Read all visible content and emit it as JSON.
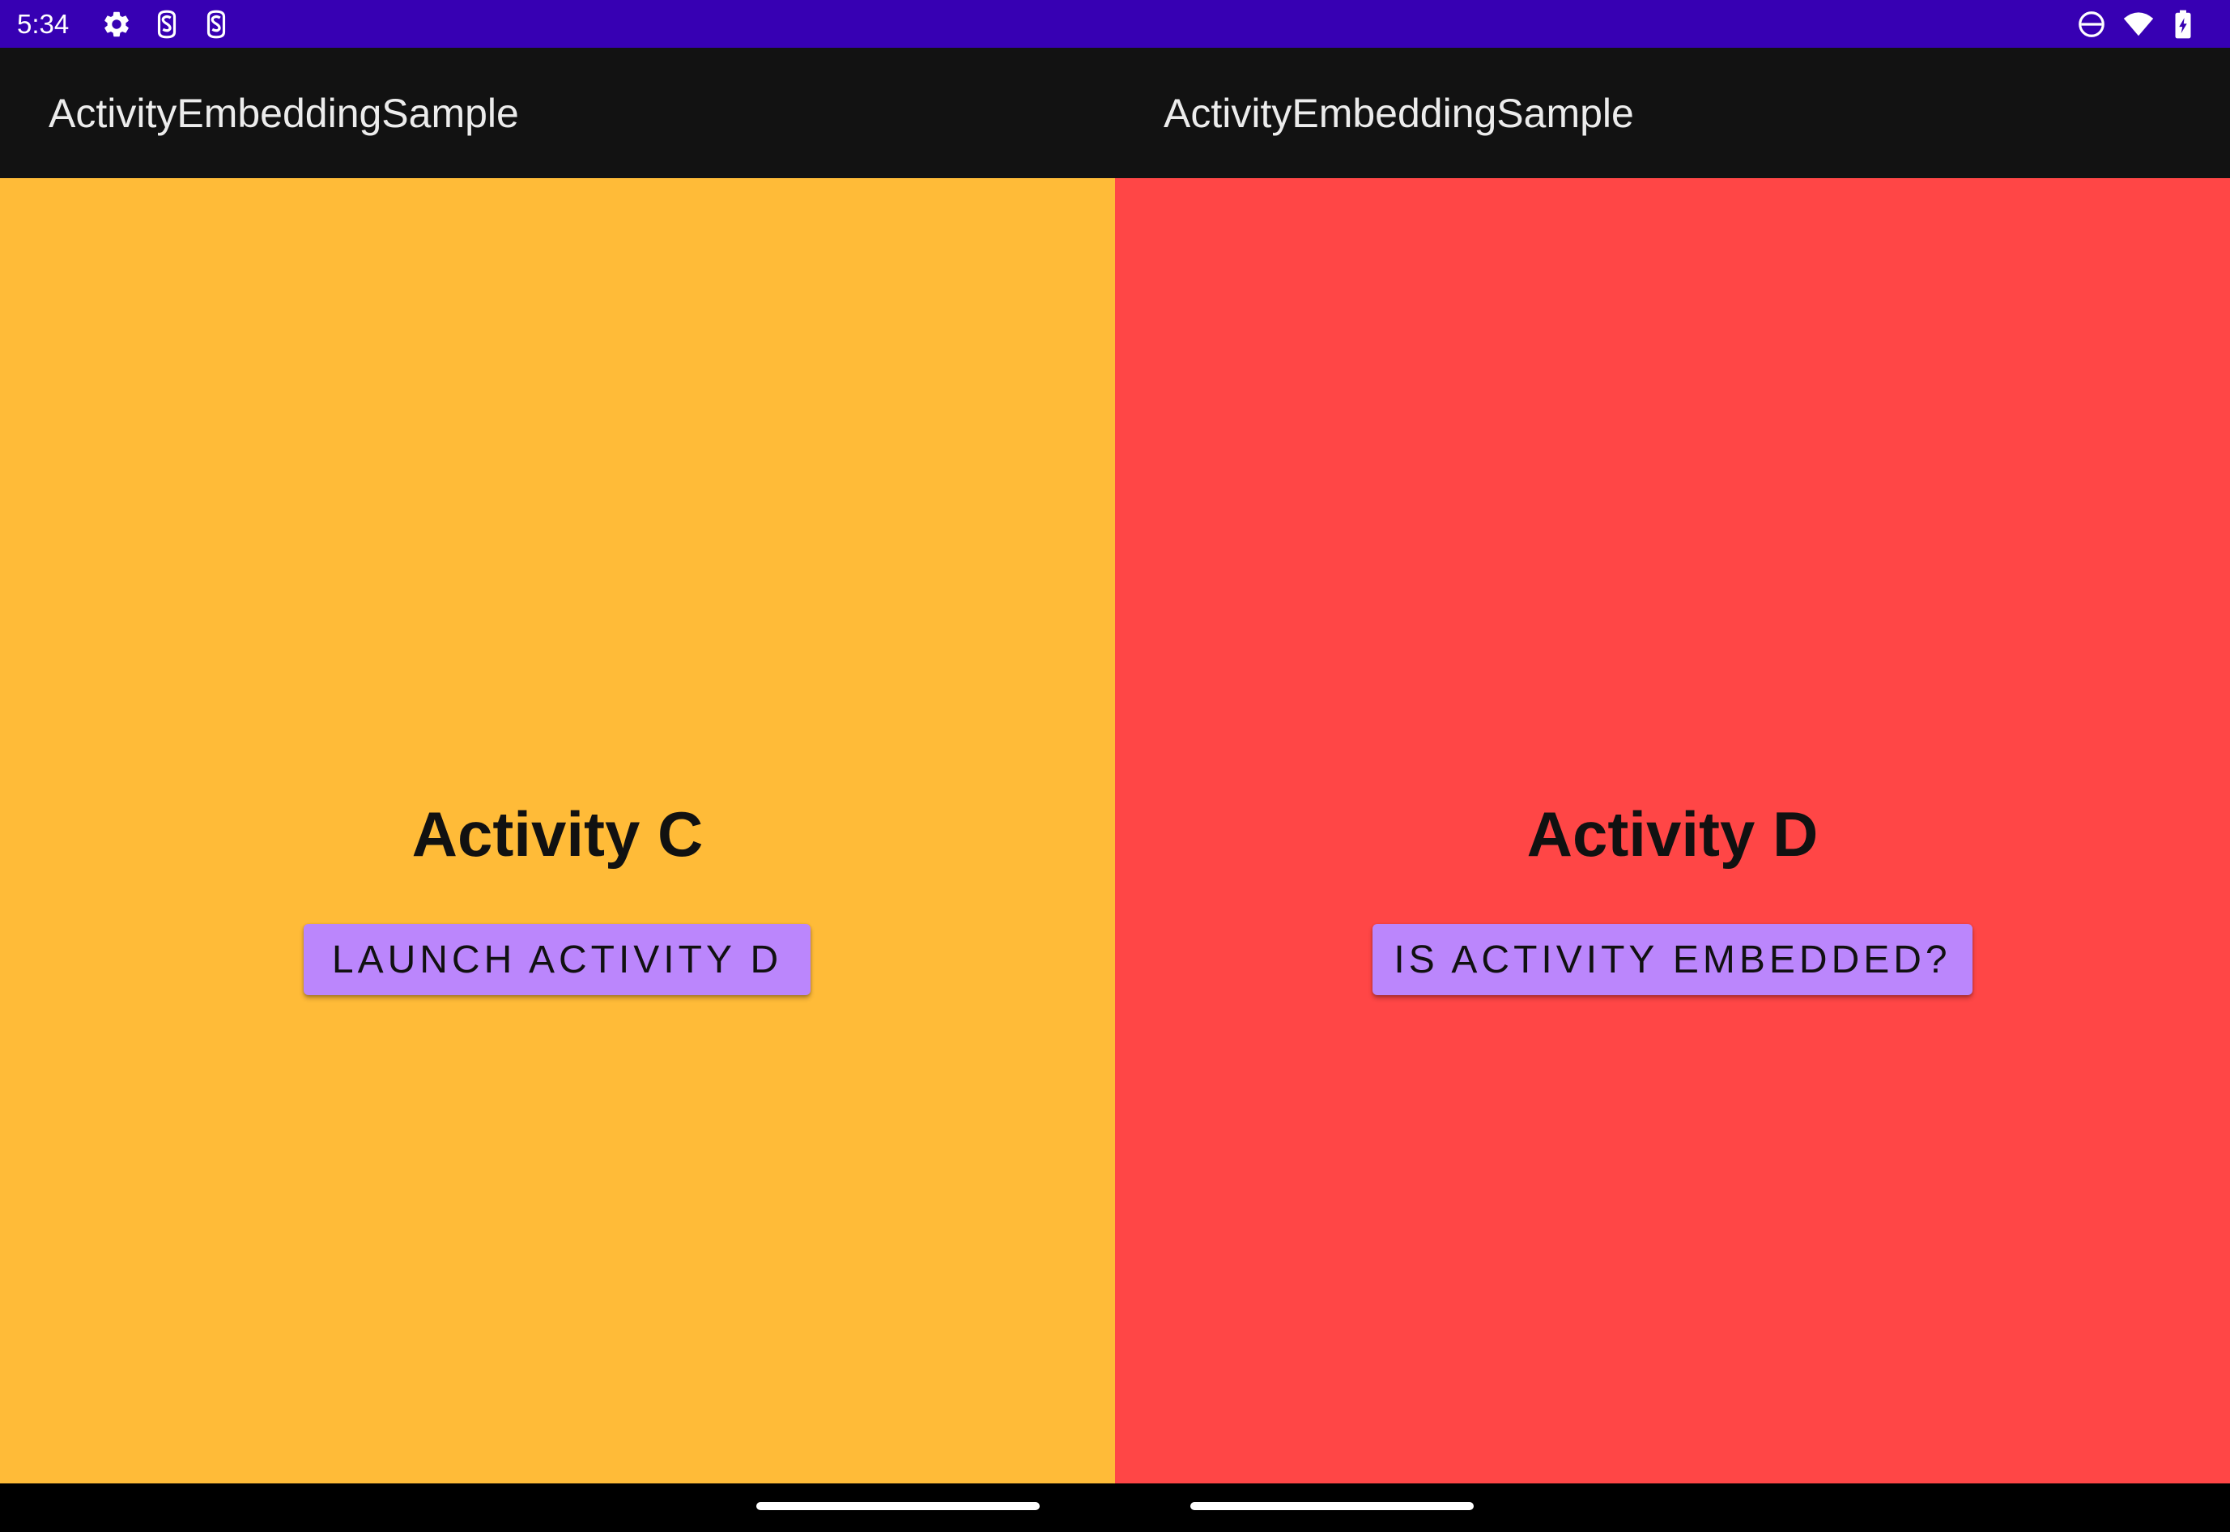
{
  "status_bar": {
    "time": "5:34",
    "background": "#3700b3",
    "left_icons": [
      "settings-gear-icon",
      "app-notification-icon",
      "app-notification-icon"
    ],
    "right_icons": [
      "do-not-disturb-icon",
      "wifi-icon",
      "battery-charging-icon"
    ]
  },
  "left_pane": {
    "toolbar_title": "ActivityEmbeddingSample",
    "background": "#ffbb38",
    "activity_title": "Activity C",
    "button_label": "LAUNCH ACTIVITY D"
  },
  "right_pane": {
    "toolbar_title": "ActivityEmbeddingSample",
    "background": "#ff4646",
    "activity_title": "Activity D",
    "button_label": "IS ACTIVITY EMBEDDED?"
  },
  "colors": {
    "toolbar": "#121212",
    "button": "#bb86fc",
    "navigation_bar": "#000000"
  },
  "navigation_bar": {
    "gesture_handles": [
      "gesture-handle",
      "gesture-handle"
    ]
  }
}
